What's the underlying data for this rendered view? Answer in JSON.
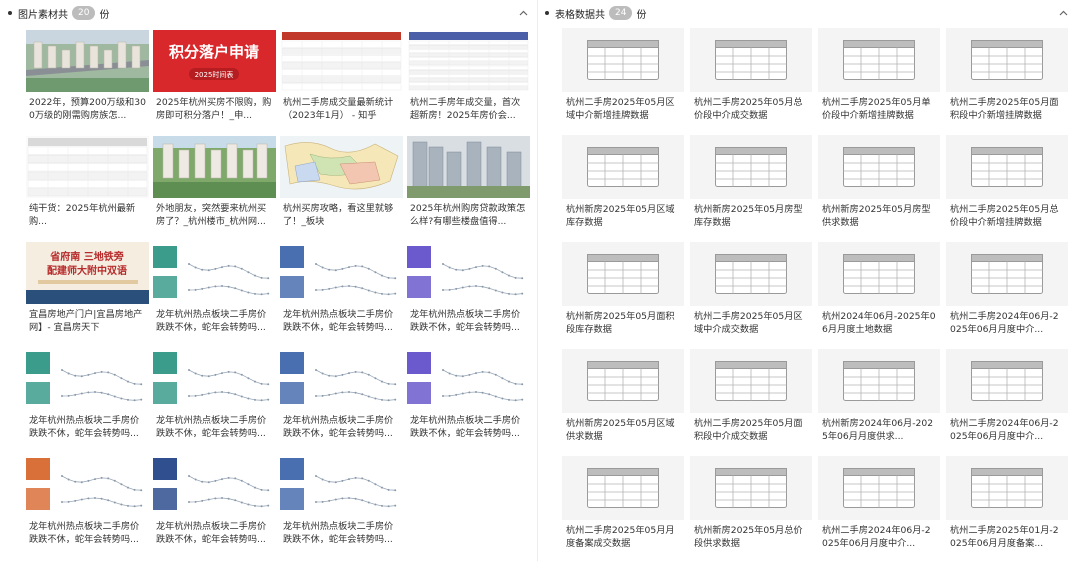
{
  "left_panel": {
    "title_prefix": "图片素材共",
    "count": "20",
    "title_suffix": "份",
    "items": [
      {
        "caption": "2022年，预算200万级和300万级的刚需购房族怎...",
        "thumb": "aerial-residential"
      },
      {
        "caption": "2025年杭州买房不限购，购房即可积分落户！_申...",
        "thumb": "red-banner"
      },
      {
        "caption": "杭州二手房成交量最新统计（2023年1月） - 知乎",
        "thumb": "red-table"
      },
      {
        "caption": "杭州二手房年成交量，首次超新房！2025年房价会...",
        "thumb": "data-table"
      },
      {
        "caption": "纯干货：2025年杭州最新购...",
        "thumb": "form-table"
      },
      {
        "caption": "外地朋友，突然要来杭州买房了？_杭州楼市_杭州网...",
        "thumb": "aerial-green"
      },
      {
        "caption": "杭州买房攻略，看这里就够了！_板块",
        "thumb": "map"
      },
      {
        "caption": "2025年杭州购房贷款政策怎么样?有哪些楼盘值得...",
        "thumb": "towers"
      },
      {
        "caption": "宜昌房地产门户|宜昌房地产网】- 宜昌房天下",
        "thumb": "promo-poster"
      },
      {
        "caption": "龙年杭州热点板块二手房价跌跌不休，蛇年会转势吗...",
        "thumb": "line-chart-teal"
      },
      {
        "caption": "龙年杭州热点板块二手房价跌跌不休，蛇年会转势吗...",
        "thumb": "line-chart-blue"
      },
      {
        "caption": "龙年杭州热点板块二手房价跌跌不休，蛇年会转势吗...",
        "thumb": "line-chart-purple"
      },
      {
        "caption": "龙年杭州热点板块二手房价跌跌不休，蛇年会转势吗...",
        "thumb": "line-chart-teal"
      },
      {
        "caption": "龙年杭州热点板块二手房价跌跌不休，蛇年会转势吗...",
        "thumb": "line-chart-teal"
      },
      {
        "caption": "龙年杭州热点板块二手房价跌跌不休，蛇年会转势吗...",
        "thumb": "line-chart-blue"
      },
      {
        "caption": "龙年杭州热点板块二手房价跌跌不休，蛇年会转势吗...",
        "thumb": "line-chart-purple"
      },
      {
        "caption": "龙年杭州热点板块二手房价跌跌不休，蛇年会转势吗...",
        "thumb": "line-chart-orange"
      },
      {
        "caption": "龙年杭州热点板块二手房价跌跌不休，蛇年会转势吗...",
        "thumb": "line-chart-darkblue"
      },
      {
        "caption": "龙年杭州热点板块二手房价跌跌不休，蛇年会转势吗...",
        "thumb": "line-chart-blue"
      }
    ]
  },
  "right_panel": {
    "title_prefix": "表格数据共",
    "count": "24",
    "title_suffix": "份",
    "items": [
      {
        "caption": "杭州二手房2025年05月区域中介新增挂牌数据"
      },
      {
        "caption": "杭州二手房2025年05月总价段中介成交数据"
      },
      {
        "caption": "杭州二手房2025年05月单价段中介新增挂牌数据"
      },
      {
        "caption": "杭州二手房2025年05月面积段中介新增挂牌数据"
      },
      {
        "caption": "杭州新房2025年05月区域库存数据"
      },
      {
        "caption": "杭州新房2025年05月房型库存数据"
      },
      {
        "caption": "杭州新房2025年05月房型供求数据"
      },
      {
        "caption": "杭州二手房2025年05月总价段中介新增挂牌数据"
      },
      {
        "caption": "杭州新房2025年05月面积段库存数据"
      },
      {
        "caption": "杭州二手房2025年05月区域中介成交数据"
      },
      {
        "caption": "杭州2024年06月-2025年06月月度土地数据"
      },
      {
        "caption": "杭州二手房2024年06月-2025年06月月度中介..."
      },
      {
        "caption": "杭州新房2025年05月区域供求数据"
      },
      {
        "caption": "杭州二手房2025年05月面积段中介成交数据"
      },
      {
        "caption": "杭州新房2024年06月-2025年06月月度供求..."
      },
      {
        "caption": "杭州二手房2024年06月-2025年06月月度中介..."
      },
      {
        "caption": "杭州二手房2025年05月月度备案成交数据"
      },
      {
        "caption": "杭州新房2025年05月总价段供求数据"
      },
      {
        "caption": "杭州二手房2024年06月-2025年06月月度中介..."
      },
      {
        "caption": "杭州二手房2025年01月-2025年06月月度备案..."
      }
    ]
  },
  "thumb_text": {
    "red_banner_title": "积分落户申请",
    "red_banner_sub": "2025时间表",
    "promo_line1": "省府南 三地铁旁",
    "promo_line2": "配建师大附中双语"
  },
  "colors": {
    "badge": "#bcbcbc",
    "teal": "#3c9c8c",
    "blue": "#4a6fb0",
    "purple": "#6a5acd",
    "orange": "#d9703a",
    "red": "#d42a2a"
  }
}
